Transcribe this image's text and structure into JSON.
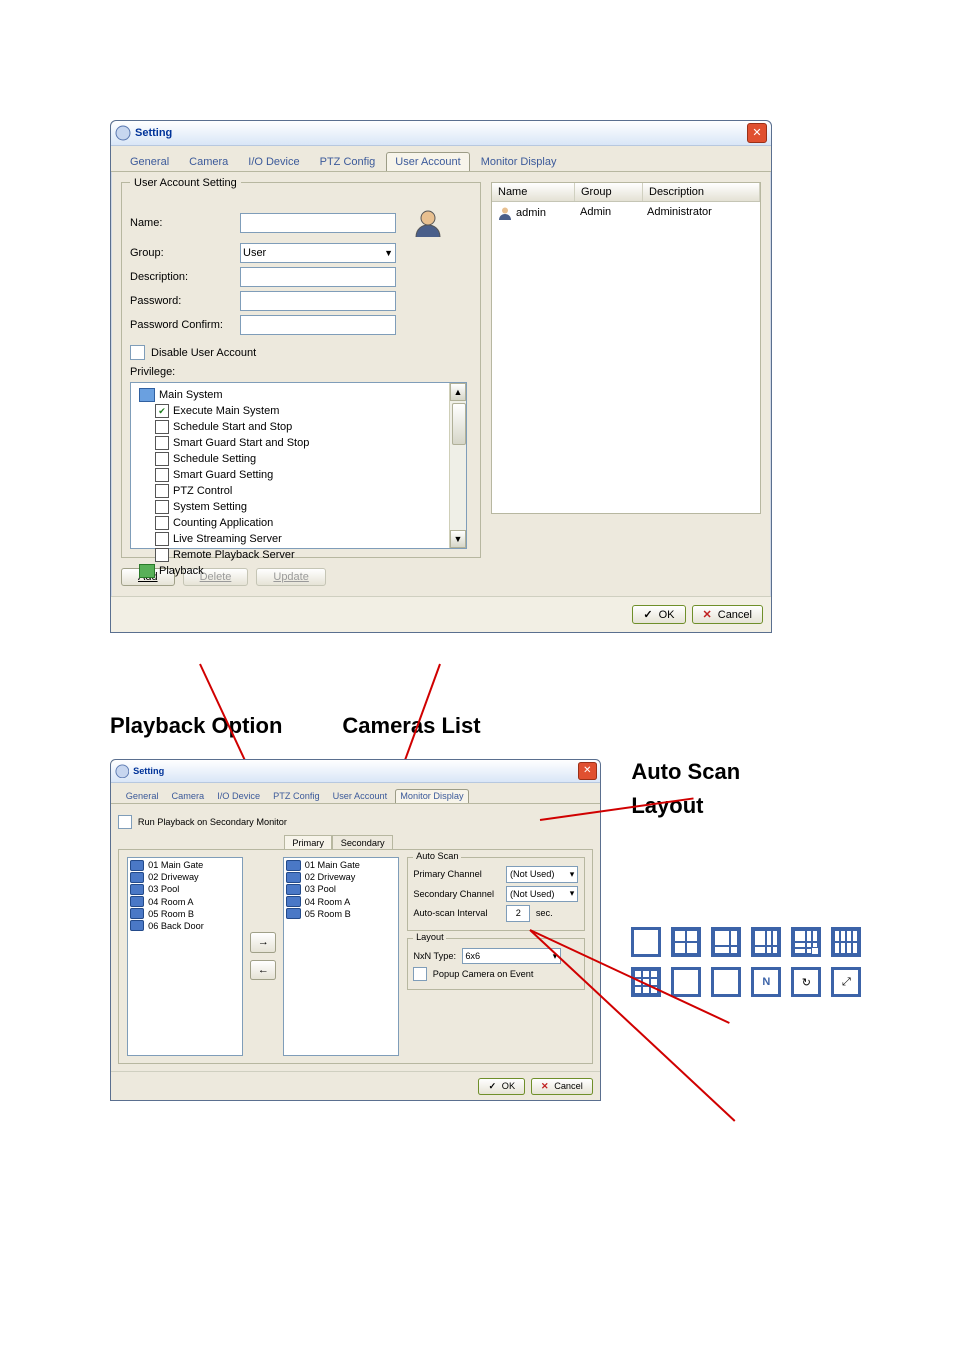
{
  "dialog1": {
    "title": "Setting",
    "tabs": [
      "General",
      "Camera",
      "I/O Device",
      "PTZ Config",
      "User Account",
      "Monitor Display"
    ],
    "active_tab_index": 4,
    "group_title": "User Account Setting",
    "labels": {
      "name": "Name:",
      "group": "Group:",
      "description": "Description:",
      "password": "Password:",
      "password_confirm": "Password Confirm:",
      "disable": "Disable User Account",
      "privilege": "Privilege:"
    },
    "group_value": "User",
    "privileges": [
      {
        "label": "Main System",
        "type": "folder",
        "indent": 0
      },
      {
        "label": "Execute Main System",
        "checked": true,
        "indent": 1
      },
      {
        "label": "Schedule Start and Stop",
        "checked": false,
        "indent": 1
      },
      {
        "label": "Smart Guard Start and Stop",
        "checked": false,
        "indent": 1
      },
      {
        "label": "Schedule Setting",
        "checked": false,
        "indent": 1
      },
      {
        "label": "Smart Guard Setting",
        "checked": false,
        "indent": 1
      },
      {
        "label": "PTZ Control",
        "checked": false,
        "indent": 1
      },
      {
        "label": "System Setting",
        "checked": false,
        "indent": 1
      },
      {
        "label": "Counting Application",
        "checked": false,
        "indent": 1
      },
      {
        "label": "Live Streaming Server",
        "checked": false,
        "indent": 1
      },
      {
        "label": "Remote Playback Server",
        "checked": false,
        "indent": 1
      },
      {
        "label": "Playback",
        "type": "folder",
        "indent": 0
      }
    ],
    "buttons": {
      "add": "Add",
      "delete": "Delete",
      "update": "Update"
    },
    "table": {
      "headers": [
        "Name",
        "Group",
        "Description"
      ],
      "rows": [
        {
          "name": "admin",
          "group": "Admin",
          "description": "Administrator"
        }
      ]
    },
    "footer": {
      "ok": "OK",
      "cancel": "Cancel"
    }
  },
  "callouts": {
    "playback_option": "Playback Option",
    "cameras_list": "Cameras List",
    "auto_scan": "Auto Scan",
    "layout": "Layout"
  },
  "dialog2": {
    "title": "Setting",
    "tabs": [
      "General",
      "Camera",
      "I/O Device",
      "PTZ Config",
      "User Account",
      "Monitor Display"
    ],
    "active_tab_index": 5,
    "run_checkbox": "Run Playback on Secondary Monitor",
    "inner_tabs": [
      "Primary",
      "Secondary"
    ],
    "active_inner_tab": 0,
    "available_cameras": [
      "01 Main Gate",
      "02 Driveway",
      "03 Pool",
      "04 Room A",
      "05 Room B",
      "06 Back Door"
    ],
    "selected_cameras": [
      "01 Main Gate",
      "02 Driveway",
      "03 Pool",
      "04 Room A",
      "05 Room B"
    ],
    "auto_scan": {
      "title": "Auto Scan",
      "primary_label": "Primary Channel",
      "primary_value": "(Not Used)",
      "secondary_label": "Secondary Channel",
      "secondary_value": "(Not Used)",
      "interval_label": "Auto-scan Interval",
      "interval_value": "2",
      "interval_unit": "sec."
    },
    "layout": {
      "title": "Layout",
      "nxn_label": "NxN Type:",
      "nxn_value": "6x6",
      "popup_label": "Popup Camera on Event"
    },
    "footer": {
      "ok": "OK",
      "cancel": "Cancel"
    }
  }
}
